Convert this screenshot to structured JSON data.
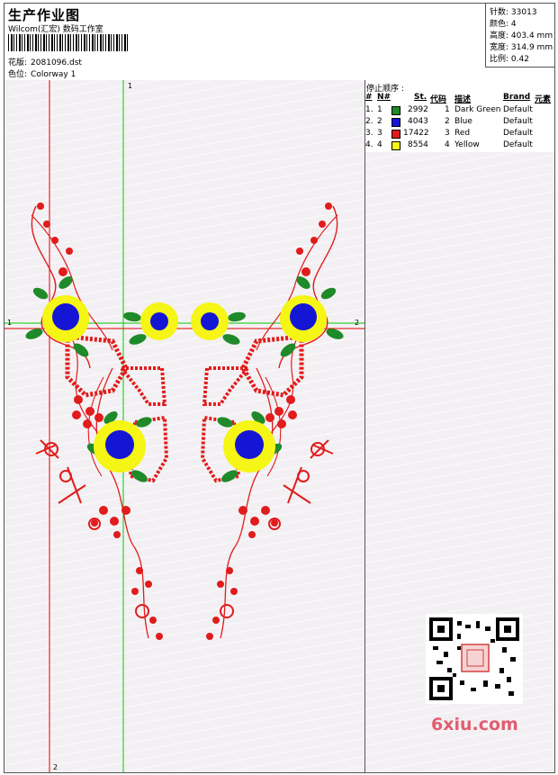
{
  "header": {
    "title": "生产作业图",
    "studio": "Wilcom(汇宏) 数码工作室",
    "design_label": "花版:",
    "design_value": "2081096.dst",
    "colorway_label": "色位:",
    "colorway_value": "Colorway 1"
  },
  "stats": [
    {
      "label": "针数:",
      "value": "33013"
    },
    {
      "label": "颜色:",
      "value": "4"
    },
    {
      "label": "高度:",
      "value": "403.4 mm"
    },
    {
      "label": "宽度:",
      "value": "314.9 mm"
    },
    {
      "label": "比例:",
      "value": "0.42"
    }
  ],
  "stop_sequence": {
    "title": "停止顺序 :",
    "columns": [
      "#",
      "N#",
      "St.",
      "代码",
      "描述",
      "Brand",
      "元素"
    ],
    "rows": [
      {
        "idx": "1.",
        "n": "1",
        "color": "#1f8a2a",
        "stitches": "2992",
        "code": "1",
        "desc": "Dark Green",
        "brand": "Default"
      },
      {
        "idx": "2.",
        "n": "2",
        "color": "#1515d6",
        "stitches": "4043",
        "code": "2",
        "desc": "Blue",
        "brand": "Default"
      },
      {
        "idx": "3.",
        "n": "3",
        "color": "#e11c1c",
        "stitches": "17422",
        "code": "3",
        "desc": "Red",
        "brand": "Default"
      },
      {
        "idx": "4.",
        "n": "4",
        "color": "#f5f516",
        "stitches": "8554",
        "code": "4",
        "desc": "Yellow",
        "brand": "Default"
      }
    ]
  },
  "guides": {
    "vertical_label": "1",
    "bottom_label": "2",
    "left_label": "1",
    "right_label": "2"
  },
  "watermark": "6xiu.com",
  "colors": {
    "green": "#1f8a2a",
    "blue": "#1515d6",
    "red": "#e11c1c",
    "yellow": "#f5f516",
    "guide_red": "#e00000",
    "guide_green": "#00cc00"
  }
}
